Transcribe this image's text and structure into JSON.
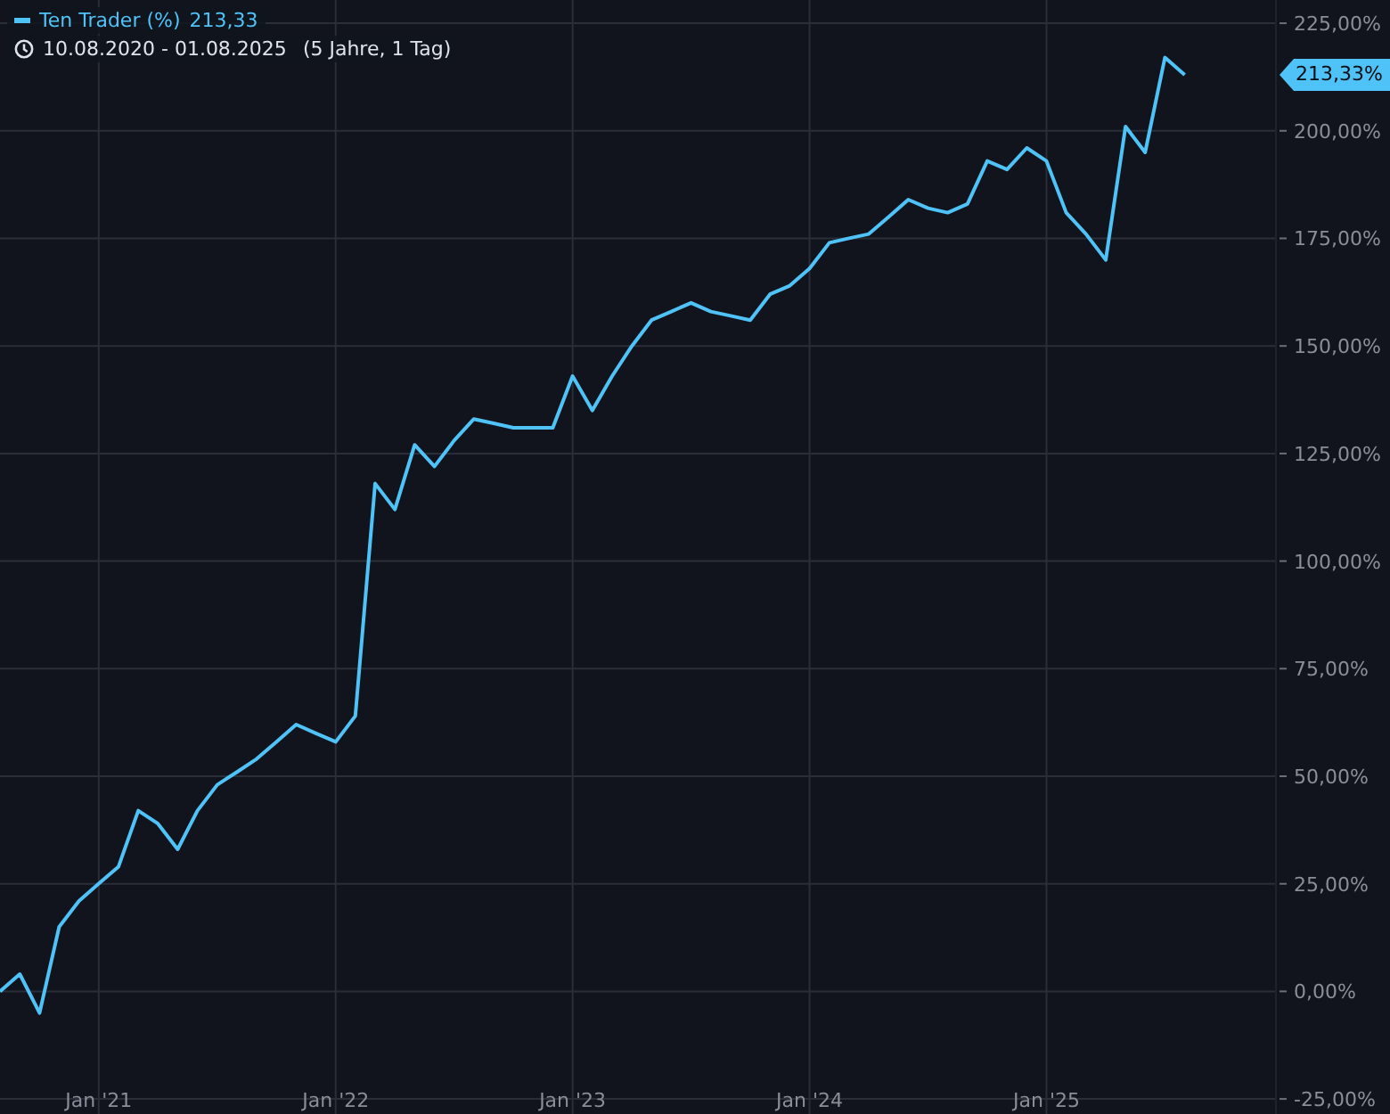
{
  "legend": {
    "value": "213,33",
    "date_range": "10.08.2020 - 01.08.2025",
    "duration": "(5 Jahre, 1 Tag)"
  },
  "price_label": "213,33%",
  "chart": {
    "chart_data": {
      "type": "line",
      "grid": true,
      "ylim": [
        -28.5,
        230.4
      ],
      "categories": [
        null,
        null,
        null,
        null,
        null,
        "Jan '21",
        null,
        null,
        null,
        null,
        null,
        null,
        null,
        null,
        null,
        null,
        null,
        "Jan '22",
        null,
        null,
        null,
        null,
        null,
        null,
        null,
        null,
        null,
        null,
        null,
        "Jan '23",
        null,
        null,
        null,
        null,
        null,
        null,
        null,
        null,
        null,
        null,
        null,
        "Jan '24",
        null,
        null,
        null,
        null,
        null,
        null,
        null,
        null,
        null,
        null,
        null,
        "Jan '25",
        null,
        null,
        null,
        null,
        null,
        null,
        null
      ],
      "series": [
        {
          "name": "Ten Trader (%)",
          "color": "#4fc3f7",
          "values": [
            0,
            4,
            -5,
            15,
            21,
            25,
            29,
            42,
            39,
            33,
            42,
            48,
            51,
            54,
            58,
            62,
            60,
            58,
            64,
            118,
            112,
            127,
            122,
            128,
            133,
            132,
            131,
            131,
            131,
            143,
            135,
            143,
            150,
            156,
            158,
            160,
            158,
            157,
            156,
            162,
            164,
            168,
            174,
            175,
            176,
            180,
            184,
            182,
            181,
            183,
            193,
            191,
            196,
            193,
            181,
            176,
            170,
            201,
            195,
            217,
            213
          ]
        }
      ],
      "yticks": [
        {
          "value": 225,
          "label": "225,00%"
        },
        {
          "value": 200,
          "label": "200,00%"
        },
        {
          "value": 175,
          "label": "175,00%"
        },
        {
          "value": 150,
          "label": "150,00%"
        },
        {
          "value": 125,
          "label": "125,00%"
        },
        {
          "value": 100,
          "label": "100,00%"
        },
        {
          "value": 75,
          "label": "75,00%"
        },
        {
          "value": 50,
          "label": "50,00%"
        },
        {
          "value": 25,
          "label": "25,00%"
        },
        {
          "value": 0,
          "label": "0,00%"
        },
        {
          "value": -25,
          "label": "-25,00%"
        }
      ]
    }
  }
}
